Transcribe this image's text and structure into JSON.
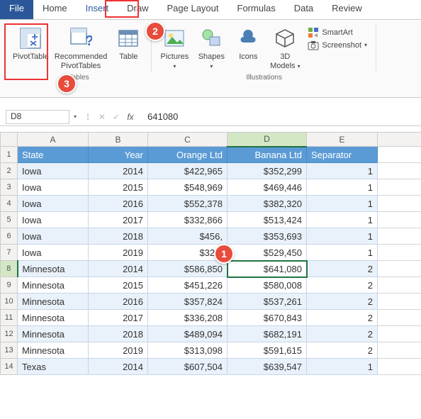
{
  "tabs": {
    "file": "File",
    "home": "Home",
    "insert": "Insert",
    "draw": "Draw",
    "page_layout": "Page Layout",
    "formulas": "Formulas",
    "data": "Data",
    "review": "Review"
  },
  "ribbon": {
    "pivot_table": "PivotTable",
    "recommended_pivot": "Recommended\nPivotTables",
    "table": "Table",
    "tables_group": "Tables",
    "pictures": "Pictures",
    "shapes": "Shapes",
    "icons": "Icons",
    "models_3d": "3D\nModels",
    "smartart": "SmartArt",
    "screenshot": "Screenshot",
    "illustrations_group": "Illustrations"
  },
  "callouts": {
    "one": "1",
    "two": "2",
    "three": "3"
  },
  "formula_bar": {
    "cell_ref": "D8",
    "value": "641080"
  },
  "columns": {
    "a": "A",
    "b": "B",
    "c": "C",
    "d": "D",
    "e": "E"
  },
  "headers": {
    "state": "State",
    "year": "Year",
    "orange": "Orange Ltd",
    "banana": "Banana Ltd",
    "separator": "Separator"
  },
  "rows": [
    {
      "n": "1"
    },
    {
      "n": "2",
      "state": "Iowa",
      "year": "2014",
      "orange": "$422,965",
      "banana": "$352,299",
      "sep": "1"
    },
    {
      "n": "3",
      "state": "Iowa",
      "year": "2015",
      "orange": "$548,969",
      "banana": "$469,446",
      "sep": "1"
    },
    {
      "n": "4",
      "state": "Iowa",
      "year": "2016",
      "orange": "$552,378",
      "banana": "$382,320",
      "sep": "1"
    },
    {
      "n": "5",
      "state": "Iowa",
      "year": "2017",
      "orange": "$332,866",
      "banana": "$513,424",
      "sep": "1"
    },
    {
      "n": "6",
      "state": "Iowa",
      "year": "2018",
      "orange": "$456,",
      "banana": "$353,693",
      "sep": "1"
    },
    {
      "n": "7",
      "state": "Iowa",
      "year": "2019",
      "orange": "$327,",
      "banana": "$529,450",
      "sep": "1"
    },
    {
      "n": "8",
      "state": "Minnesota",
      "year": "2014",
      "orange": "$586,850",
      "banana": "$641,080",
      "sep": "2"
    },
    {
      "n": "9",
      "state": "Minnesota",
      "year": "2015",
      "orange": "$451,226",
      "banana": "$580,008",
      "sep": "2"
    },
    {
      "n": "10",
      "state": "Minnesota",
      "year": "2016",
      "orange": "$357,824",
      "banana": "$537,261",
      "sep": "2"
    },
    {
      "n": "11",
      "state": "Minnesota",
      "year": "2017",
      "orange": "$336,208",
      "banana": "$670,843",
      "sep": "2"
    },
    {
      "n": "12",
      "state": "Minnesota",
      "year": "2018",
      "orange": "$489,094",
      "banana": "$682,191",
      "sep": "2"
    },
    {
      "n": "13",
      "state": "Minnesota",
      "year": "2019",
      "orange": "$313,098",
      "banana": "$591,615",
      "sep": "2"
    },
    {
      "n": "14",
      "state": "Texas",
      "year": "2014",
      "orange": "$607,504",
      "banana": "$639,547",
      "sep": "1"
    }
  ]
}
